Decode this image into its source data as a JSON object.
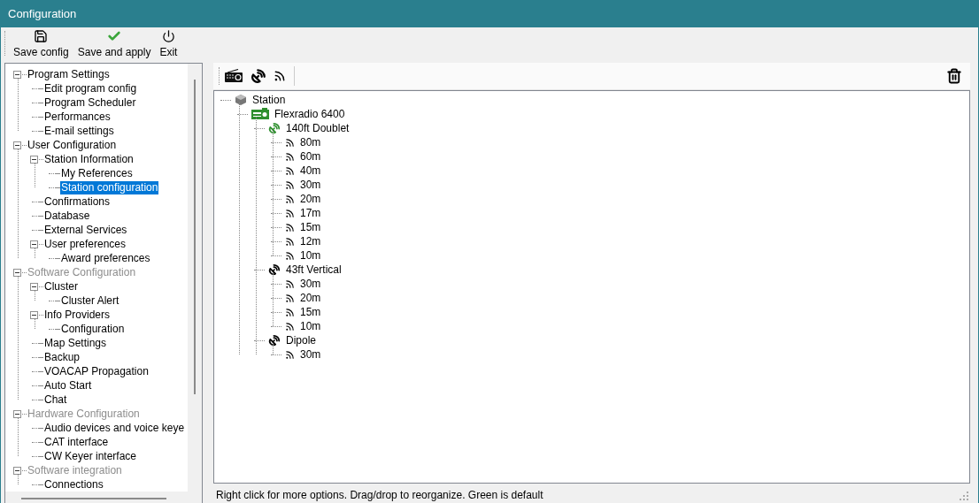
{
  "window": {
    "title": "Configuration"
  },
  "toolbar": [
    {
      "kind": "save",
      "label": "Save config"
    },
    {
      "kind": "apply",
      "label": "Save and apply"
    },
    {
      "kind": "exit",
      "label": "Exit"
    }
  ],
  "nav_tree": [
    {
      "label": "Program Settings",
      "disabled": false,
      "selected": false,
      "expanded": true,
      "children": [
        {
          "label": "Edit program config",
          "disabled": false,
          "selected": false
        },
        {
          "label": "Program Scheduler",
          "disabled": false,
          "selected": false
        },
        {
          "label": "Performances",
          "disabled": false,
          "selected": false
        },
        {
          "label": "E-mail settings",
          "disabled": false,
          "selected": false
        }
      ]
    },
    {
      "label": "User Configuration",
      "disabled": false,
      "selected": false,
      "expanded": true,
      "children": [
        {
          "label": "Station Information",
          "disabled": false,
          "selected": false,
          "expanded": true,
          "children": [
            {
              "label": "My References",
              "disabled": false,
              "selected": false
            },
            {
              "label": "Station configuration",
              "disabled": false,
              "selected": true
            }
          ]
        },
        {
          "label": "Confirmations",
          "disabled": false,
          "selected": false
        },
        {
          "label": "Database",
          "disabled": false,
          "selected": false
        },
        {
          "label": "External Services",
          "disabled": false,
          "selected": false
        },
        {
          "label": "User preferences",
          "disabled": false,
          "selected": false,
          "expanded": true,
          "children": [
            {
              "label": "Award preferences",
              "disabled": false,
              "selected": false
            }
          ]
        }
      ]
    },
    {
      "label": "Software Configuration",
      "disabled": true,
      "selected": false,
      "expanded": true,
      "children": [
        {
          "label": "Cluster",
          "disabled": false,
          "selected": false,
          "expanded": true,
          "children": [
            {
              "label": "Cluster Alert",
              "disabled": false,
              "selected": false
            }
          ]
        },
        {
          "label": "Info Providers",
          "disabled": false,
          "selected": false,
          "expanded": true,
          "children": [
            {
              "label": "Configuration",
              "disabled": false,
              "selected": false
            }
          ]
        },
        {
          "label": "Map Settings",
          "disabled": false,
          "selected": false
        },
        {
          "label": "Backup",
          "disabled": false,
          "selected": false
        },
        {
          "label": "VOACAP Propagation",
          "disabled": false,
          "selected": false
        },
        {
          "label": "Auto Start",
          "disabled": false,
          "selected": false
        },
        {
          "label": "Chat",
          "disabled": false,
          "selected": false
        }
      ]
    },
    {
      "label": "Hardware Configuration",
      "disabled": true,
      "selected": false,
      "expanded": true,
      "children": [
        {
          "label": "Audio devices and voice keye",
          "disabled": false,
          "selected": false
        },
        {
          "label": "CAT interface",
          "disabled": false,
          "selected": false
        },
        {
          "label": "CW Keyer interface",
          "disabled": false,
          "selected": false
        }
      ]
    },
    {
      "label": "Software integration",
      "disabled": true,
      "selected": false,
      "expanded": true,
      "children": [
        {
          "label": "Connections",
          "disabled": false,
          "selected": false
        }
      ]
    }
  ],
  "station_toolbar": [
    {
      "kind": "radio"
    },
    {
      "kind": "antenna"
    },
    {
      "kind": "band"
    }
  ],
  "station_tree": [
    {
      "kind": "station",
      "label": "Station",
      "default": false,
      "children": [
        {
          "kind": "radio",
          "label": "Flexradio 6400",
          "default": true,
          "children": [
            {
              "kind": "antenna",
              "label": "140ft Doublet",
              "default": true,
              "children": [
                {
                  "kind": "band",
                  "label": "80m",
                  "default": false
                },
                {
                  "kind": "band",
                  "label": "60m",
                  "default": false
                },
                {
                  "kind": "band",
                  "label": "40m",
                  "default": false
                },
                {
                  "kind": "band",
                  "label": "30m",
                  "default": false
                },
                {
                  "kind": "band",
                  "label": "20m",
                  "default": false
                },
                {
                  "kind": "band",
                  "label": "17m",
                  "default": false
                },
                {
                  "kind": "band",
                  "label": "15m",
                  "default": false
                },
                {
                  "kind": "band",
                  "label": "12m",
                  "default": false
                },
                {
                  "kind": "band",
                  "label": "10m",
                  "default": false
                }
              ]
            },
            {
              "kind": "antenna",
              "label": "43ft Vertical",
              "default": false,
              "children": [
                {
                  "kind": "band",
                  "label": "30m",
                  "default": false
                },
                {
                  "kind": "band",
                  "label": "20m",
                  "default": false
                },
                {
                  "kind": "band",
                  "label": "15m",
                  "default": false
                },
                {
                  "kind": "band",
                  "label": "10m",
                  "default": false
                }
              ]
            },
            {
              "kind": "antenna",
              "label": "Dipole",
              "default": false,
              "children": [
                {
                  "kind": "band",
                  "label": "30m",
                  "default": false
                }
              ]
            }
          ]
        }
      ]
    }
  ],
  "status_bar": "Right click for more options. Drag/drop to reorganize. Green is default"
}
